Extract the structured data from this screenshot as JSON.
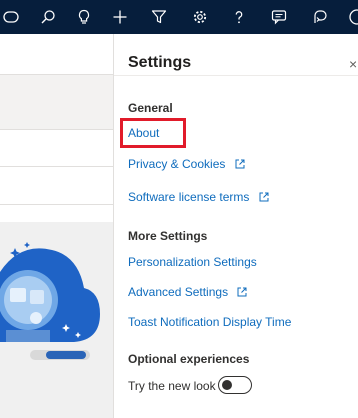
{
  "topbar": {
    "icons": [
      "pill-icon",
      "search-icon",
      "lightbulb-icon",
      "plus-icon",
      "filter-icon",
      "gear-icon",
      "help-icon",
      "chat-icon",
      "feedback-icon",
      "avatar-icon"
    ]
  },
  "panel": {
    "title": "Settings",
    "close": "×",
    "general": {
      "heading": "General",
      "about": "About",
      "privacy": "Privacy & Cookies",
      "license": "Software license terms"
    },
    "more": {
      "heading": "More Settings",
      "personalization": "Personalization Settings",
      "advanced": "Advanced Settings",
      "toast": "Toast Notification Display Time"
    },
    "optional": {
      "heading": "Optional experiences",
      "try_new_look": "Try the new look",
      "toggle_on": false
    }
  },
  "colors": {
    "topbar": "#061e3c",
    "link": "#0f6cbd",
    "highlight": "#e11b2a"
  }
}
